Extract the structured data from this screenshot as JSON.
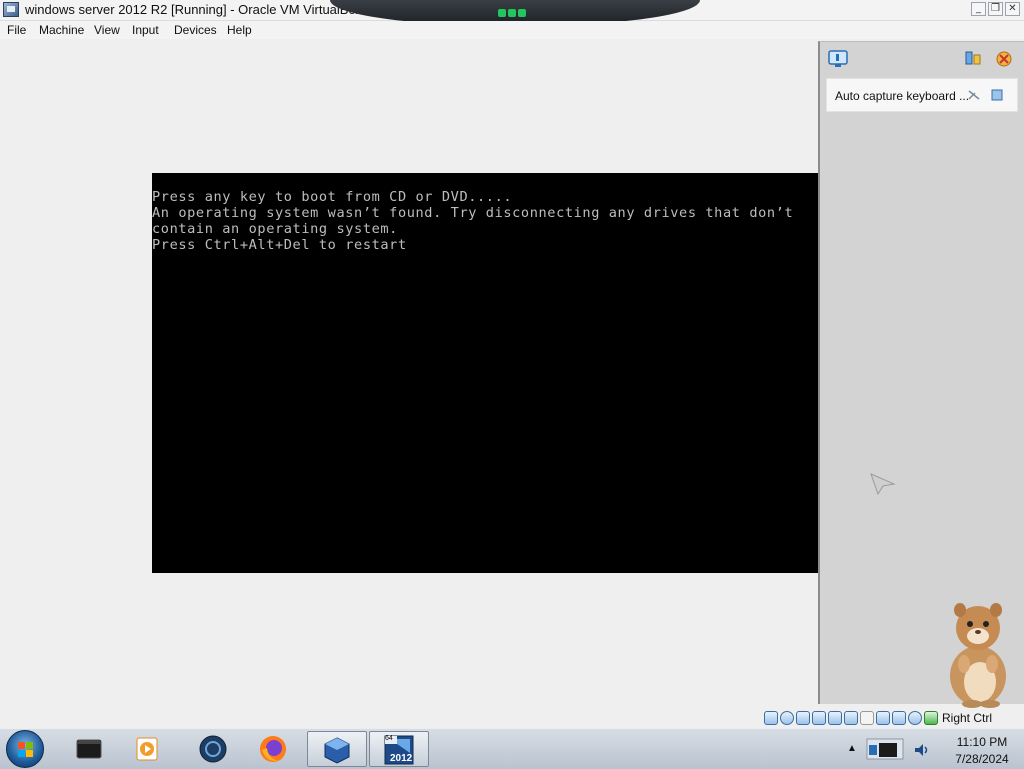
{
  "window": {
    "title": "windows server 2012 R2 [Running] - Oracle VM VirtualBox",
    "controls": {
      "minimize": "_",
      "restore": "❐",
      "close": "✕"
    }
  },
  "menu": [
    "File",
    "Machine",
    "View",
    "Input",
    "Devices",
    "Help"
  ],
  "vm_screen": {
    "lines": [
      "Press any key to boot from CD or DVD.....",
      "An operating system wasn’t found. Try disconnecting any drives that don’t",
      "contain an operating system.",
      "Press Ctrl+Alt+Del to restart"
    ]
  },
  "side_panel": {
    "auto_capture_label": "Auto capture keyboard ...",
    "icons": [
      "monitor-icon",
      "settings-icon",
      "discard-icon",
      "pin-icon",
      "close-icon"
    ]
  },
  "statusbar": {
    "host_key": "Right Ctrl",
    "icons": [
      "hard-disk-icon",
      "optical-disk-icon",
      "audio-icon",
      "network-icon",
      "usb-icon",
      "shared-folders-icon",
      "display-icon",
      "recording-icon",
      "cpu-icon",
      "mouse-integration-icon",
      "keyboard-icon"
    ]
  },
  "taskbar": {
    "apps": [
      "terminal-app-icon",
      "media-player-app-icon",
      "globe-app-icon",
      "firefox-app-icon",
      "virtualbox-app-icon",
      "windows-server-2012-app-icon"
    ],
    "vm_badge_top": "64",
    "vm_badge_bottom": "2012",
    "clock_time": "11:10 PM",
    "clock_date": "7/28/2024"
  },
  "colors": {
    "vm_background": "#000000",
    "vm_text": "#bdbdbd",
    "accent_green": "#22c55e"
  }
}
